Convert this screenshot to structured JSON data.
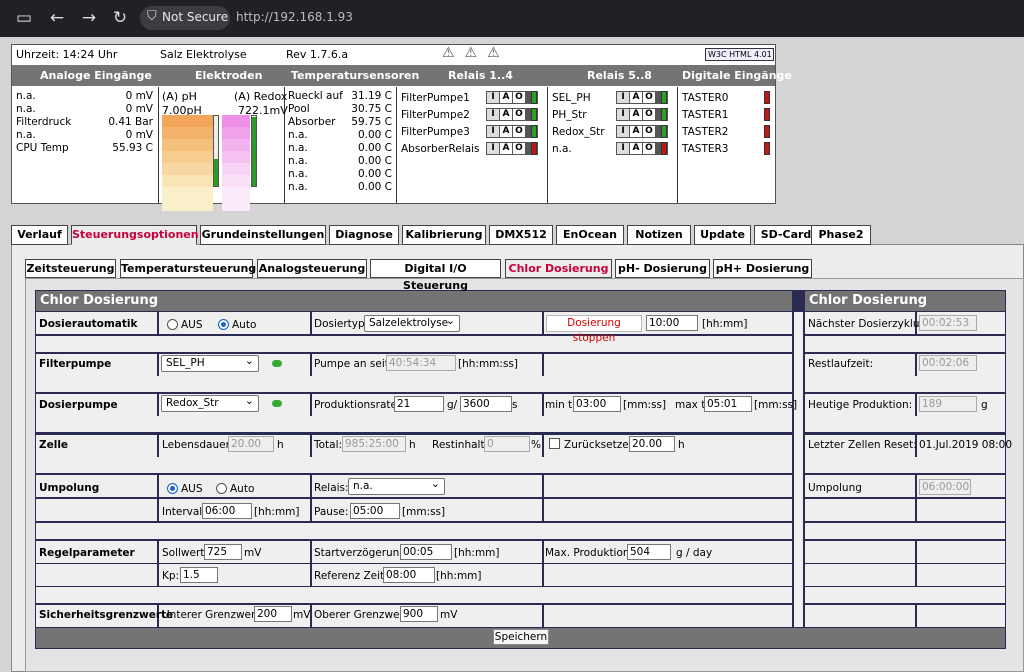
{
  "browser": {
    "not_secure": "Not Secure",
    "url": "http://192.168.1.93"
  },
  "status": {
    "time": "Uhrzeit: 14:24 Uhr",
    "name": "Salz Elektrolyse",
    "rev": "Rev 1.7.6.a",
    "validator": "HTML 4.01"
  },
  "headers": [
    "Analoge Eingänge",
    "Elektroden",
    "Temperatursensoren",
    "Relais 1..4",
    "Relais 5..8",
    "Digitale Eingänge"
  ],
  "analog": [
    {
      "label": "n.a.",
      "value": "0 mV"
    },
    {
      "label": "n.a.",
      "value": "0 mV"
    },
    {
      "label": "Filterdruck",
      "value": "0.41 Bar"
    },
    {
      "label": "n.a.",
      "value": "0 mV"
    },
    {
      "label": "CPU Temp",
      "value": "55.93 C"
    }
  ],
  "electrodes": {
    "ph_label": "(A) pH",
    "redox_label": "(A) Redox",
    "ph_value": "7.00pH",
    "redox_value": "722.1mV"
  },
  "temps": [
    {
      "label": "Rueckl auf",
      "value": "31.19 C"
    },
    {
      "label": "Pool",
      "value": "30.75 C"
    },
    {
      "label": "Absorber",
      "value": "59.75 C"
    },
    {
      "label": "n.a.",
      "value": "0.00 C"
    },
    {
      "label": "n.a.",
      "value": "0.00 C"
    },
    {
      "label": "n.a.",
      "value": "0.00 C"
    },
    {
      "label": "n.a.",
      "value": "0.00 C"
    },
    {
      "label": "n.a.",
      "value": "0.00 C"
    }
  ],
  "relais1": [
    {
      "label": "FilterPumpe1",
      "state": "on"
    },
    {
      "label": "FilterPumpe2",
      "state": "on"
    },
    {
      "label": "FilterPumpe3",
      "state": "on"
    },
    {
      "label": "AbsorberRelais",
      "state": "off"
    }
  ],
  "relais2": [
    {
      "label": "SEL_PH",
      "state": "on"
    },
    {
      "label": "PH_Str",
      "state": "on"
    },
    {
      "label": "Redox_Str",
      "state": "on"
    },
    {
      "label": "n.a.",
      "state": "off"
    }
  ],
  "iao": [
    "I",
    "A",
    "O"
  ],
  "digital": [
    "TASTER0",
    "TASTER1",
    "TASTER2",
    "TASTER3"
  ],
  "tabs": [
    "Verlauf",
    "Steuerungsoptionen",
    "Grundeinstellungen",
    "Diagnose",
    "Kalibrierung",
    "DMX512",
    "EnOcean",
    "Notizen",
    "Update",
    "SD-Card",
    "Phase2"
  ],
  "subtabs": [
    "Zeitsteuerung",
    "Temperatursteuerung",
    "Analogsteuerung",
    "Digital I/O Steuerung",
    "Chlor Dosierung",
    "pH- Dosierung",
    "pH+ Dosierung"
  ],
  "form": {
    "title": "Chlor Dosierung",
    "title_right": "Chlor Dosierung",
    "dosierautomatik": "Dosierautomatik",
    "aus": "AUS",
    "auto": "Auto",
    "dosiertyp": "Dosiertyp:",
    "dosiertyp_value": "Salzelektrolyse",
    "stop_btn": "Dosierung stoppen",
    "stop_time": "10:00",
    "hhmm": "[hh:mm]",
    "next_label": "Nächster Dosierzyklus:",
    "next_value": "00:02:53",
    "filterpumpe": "Filterpumpe",
    "filter_sel": "SEL_PH",
    "pumpe_an": "Pumpe an seit:",
    "pumpe_an_value": "40:54:34",
    "hhmmss": "[hh:mm:ss]",
    "rest_label": "Restlaufzeit:",
    "rest_value": "00:02:06",
    "dosierpumpe": "Dosierpumpe",
    "dosier_sel": "Redox_Str",
    "prodrate": "Produktionsrate:",
    "prod1": "21",
    "prod_g": "g/",
    "prod2": "3600",
    "prod_s": "s",
    "mint": "min t:",
    "mint_value": "03:00",
    "mmss": "[mm:ss]",
    "maxt": "max t:",
    "maxt_value": "05:01",
    "heute_label": "Heutige Produktion:",
    "heute_value": "189",
    "heute_unit": "g",
    "zelle": "Zelle",
    "lebensdauer": "Lebensdauer:",
    "lebensdauer_value": "20.00",
    "h": "h",
    "total": "Total:",
    "total_value": "985:25:00",
    "restinhalt": "Restinhalt:",
    "restinhalt_value": "0",
    "percent": "%",
    "reset_label": "Zurücksetzen",
    "reset_value": "20.00",
    "zellreset_label": "Letzter Zellen Reset:",
    "zellreset_value": "01.Jul.2019 08:00",
    "umpolung": "Umpolung",
    "relais": "Relais:",
    "relais_sel": "n.a.",
    "interval": "Interval:",
    "interval_value": "06:00",
    "pause": "Pause:",
    "pause_value": "05:00",
    "umpolung_r": "Umpolung",
    "umpolung_r_value": "06:00:00",
    "regel": "Regelparameter",
    "sollwert": "Sollwert:",
    "sollwert_value": "725",
    "mv": "mV",
    "startv": "Startverzögerung:",
    "startv_value": "00:05",
    "maxprod": "Max. Produktion:",
    "maxprod_value": "504",
    "gday": "g / day",
    "kp": "Kp:",
    "kp_value": "1.5",
    "refzeit": "Referenz Zeit:",
    "refzeit_value": "08:00",
    "sicher": "Sicherheitsgrenzwerte",
    "unterer": "Unterer Grenzwert:",
    "unterer_value": "200",
    "oberer": "Oberer Grenzwert:",
    "oberer_value": "900",
    "save": "Speichern"
  },
  "colors": {
    "accent": "#c8003c",
    "header": "#747474",
    "table_border": "#2a2a52"
  }
}
